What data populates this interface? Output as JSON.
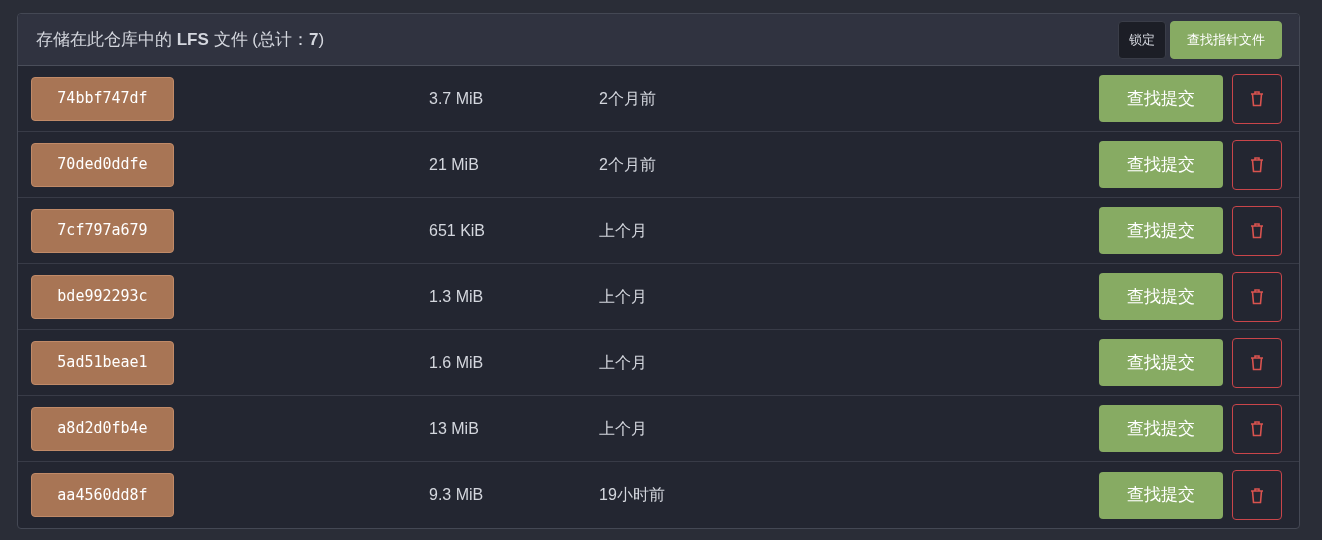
{
  "header": {
    "title": "存储在此仓库中的 **LFS** 文件 (总计：**7**)",
    "buttons": [
      {
        "label": "锁定",
        "kind": "dark"
      },
      {
        "label": "查找指针文件",
        "kind": "primary"
      }
    ]
  },
  "files": [
    {
      "oid": "74bbf747df",
      "size": "3.7 MiB",
      "time": "2个月前",
      "action": "查找提交"
    },
    {
      "oid": "70ded0ddfe",
      "size": "21 MiB",
      "time": "2个月前",
      "action": "查找提交"
    },
    {
      "oid": "7cf797a679",
      "size": "651 KiB",
      "time": "上个月",
      "action": "查找提交"
    },
    {
      "oid": "bde992293c",
      "size": "1.3 MiB",
      "time": "上个月",
      "action": "查找提交"
    },
    {
      "oid": "5ad51beae1",
      "size": "1.6 MiB",
      "time": "上个月",
      "action": "查找提交"
    },
    {
      "oid": "a8d2d0fb4e",
      "size": "13 MiB",
      "time": "上个月",
      "action": "查找提交"
    },
    {
      "oid": "aa4560dd8f",
      "size": "9.3 MiB",
      "time": "19小时前",
      "action": "查找提交"
    }
  ]
}
